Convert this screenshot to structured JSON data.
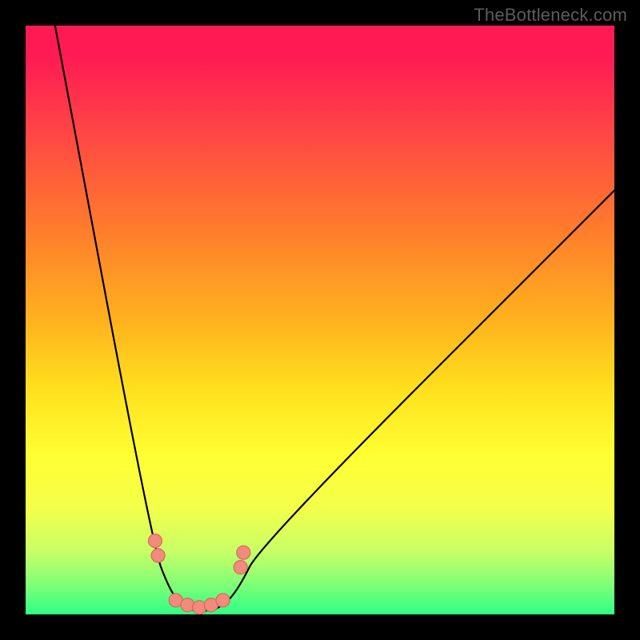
{
  "watermark": "TheBottleneck.com",
  "chart_data": {
    "type": "line",
    "title": "",
    "xlabel": "",
    "ylabel": "",
    "xlim": [
      0,
      100
    ],
    "ylim": [
      0,
      100
    ],
    "grid": false,
    "series": [
      {
        "name": "main-curve",
        "x": [
          5,
          21.5,
          24.5,
          27,
          30,
          33,
          36,
          40,
          100
        ],
        "y": [
          100,
          12,
          4,
          1,
          0.5,
          1,
          4,
          12,
          72
        ]
      }
    ],
    "markers": [
      {
        "name": "left-pair-top",
        "x": 22.0,
        "y": 12.5
      },
      {
        "name": "left-pair-bottom",
        "x": 22.5,
        "y": 10.0
      },
      {
        "name": "floor-1",
        "x": 25.5,
        "y": 2.4
      },
      {
        "name": "floor-2",
        "x": 27.5,
        "y": 1.6
      },
      {
        "name": "floor-3",
        "x": 29.5,
        "y": 1.2
      },
      {
        "name": "floor-4",
        "x": 31.5,
        "y": 1.6
      },
      {
        "name": "floor-5",
        "x": 33.5,
        "y": 2.4
      },
      {
        "name": "right-pair-bottom",
        "x": 36.5,
        "y": 8.0
      },
      {
        "name": "right-pair-top",
        "x": 37.0,
        "y": 10.5
      }
    ],
    "background": {
      "type": "vertical-gradient",
      "stops": [
        {
          "pos": 0,
          "color": "#ff1a54"
        },
        {
          "pos": 18,
          "color": "#ff4545"
        },
        {
          "pos": 34,
          "color": "#ff7a2d"
        },
        {
          "pos": 50,
          "color": "#ffb21e"
        },
        {
          "pos": 62,
          "color": "#ffe11e"
        },
        {
          "pos": 73,
          "color": "#ffff33"
        },
        {
          "pos": 89,
          "color": "#caff66"
        },
        {
          "pos": 100,
          "color": "#2fff85"
        }
      ]
    }
  }
}
